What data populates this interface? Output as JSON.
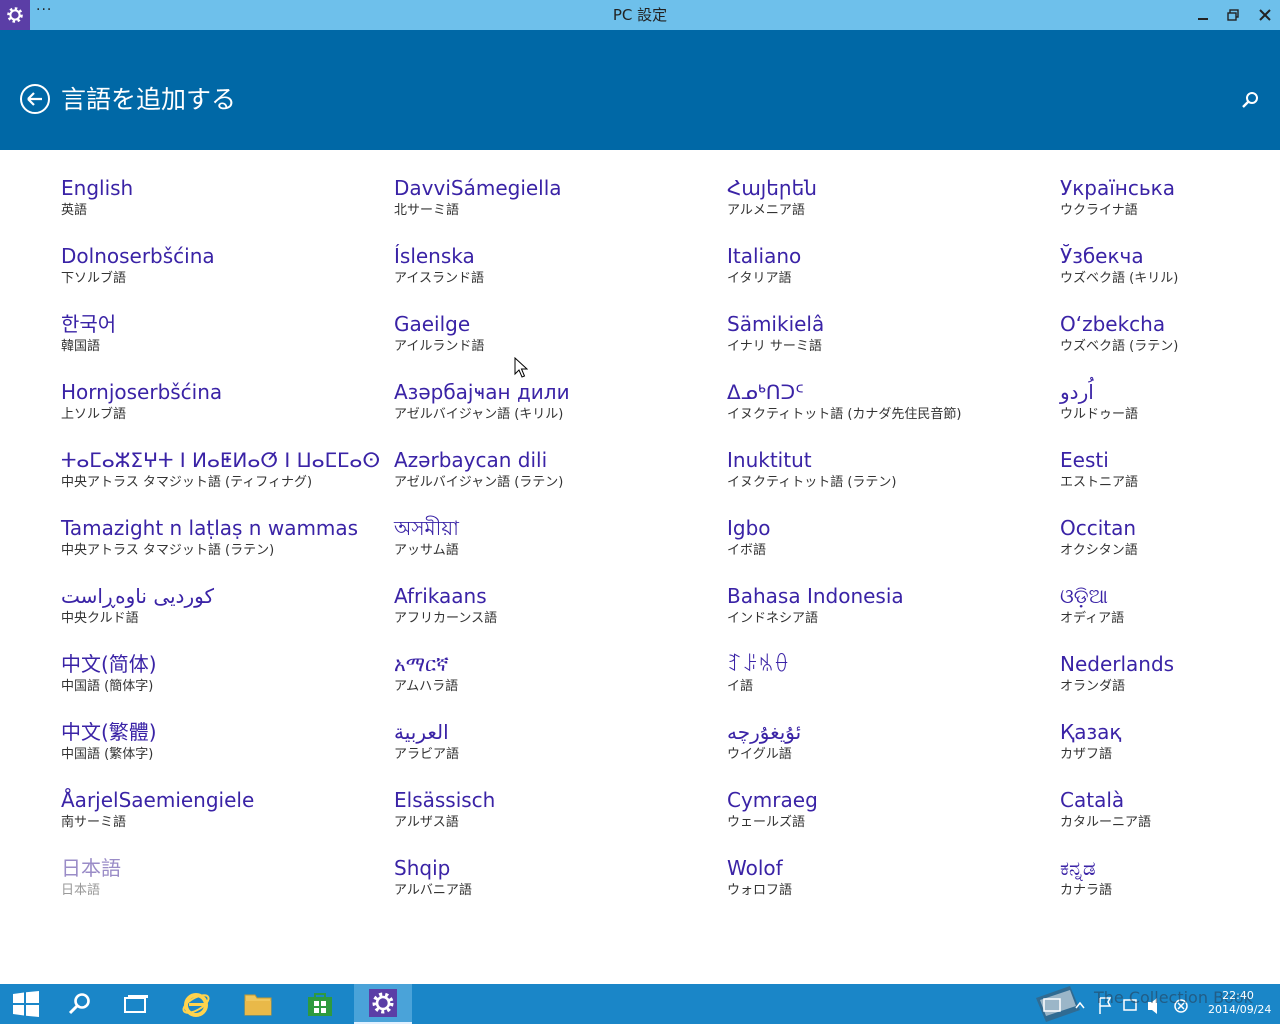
{
  "window": {
    "title": "PC 設定",
    "menu_glyph": "···"
  },
  "header": {
    "title": "言語を追加する"
  },
  "languages": [
    {
      "native": "English",
      "japanese": "英語"
    },
    {
      "native": "Dolnoserbšćina",
      "japanese": "下ソルブ語"
    },
    {
      "native": "한국어",
      "japanese": "韓国語"
    },
    {
      "native": "Hornjoserbšćina",
      "japanese": "上ソルブ語"
    },
    {
      "native": "ⵜⴰⵎⴰⵣⵉⵖⵜ ⵏ ⵍⴰⵟⵍⴰⵚ ⵏ ⵡⴰⵎⵎⴰⵙ",
      "japanese": "中央アトラス タマジット語 (ティフィナグ)"
    },
    {
      "native": "Tamazight n laṭlaṣ n wammas",
      "japanese": "中央アトラス タマジット語 (ラテン)"
    },
    {
      "native": "کوردیی ناوەڕاست",
      "japanese": "中央クルド語"
    },
    {
      "native": "中文(简体)",
      "japanese": "中国語 (簡体字)"
    },
    {
      "native": "中文(繁體)",
      "japanese": "中国語 (繁体字)"
    },
    {
      "native": "ÅarjelSaemiengiele",
      "japanese": "南サーミ語"
    },
    {
      "native": "日本語",
      "japanese": "日本語",
      "disabled": true
    },
    {
      "native": "DavviSámegiella",
      "japanese": "北サーミ語"
    },
    {
      "native": "Íslenska",
      "japanese": "アイスランド語"
    },
    {
      "native": "Gaeilge",
      "japanese": "アイルランド語"
    },
    {
      "native": "Азәрбајҹан дили",
      "japanese": "アゼルバイジャン語 (キリル)"
    },
    {
      "native": "Azərbaycan dili",
      "japanese": "アゼルバイジャン語 (ラテン)"
    },
    {
      "native": "অসমীয়া",
      "japanese": "アッサム語"
    },
    {
      "native": "Afrikaans",
      "japanese": "アフリカーンス語"
    },
    {
      "native": "አማርኛ",
      "japanese": "アムハラ語"
    },
    {
      "native": "العربية",
      "japanese": "アラビア語"
    },
    {
      "native": "Elsässisch",
      "japanese": "アルザス語"
    },
    {
      "native": "Shqip",
      "japanese": "アルバニア語"
    },
    {
      "native": "Հայերեն",
      "japanese": "アルメニア語"
    },
    {
      "native": "Italiano",
      "japanese": "イタリア語"
    },
    {
      "native": "Sämikielâ",
      "japanese": "イナリ サーミ語"
    },
    {
      "native": "ᐃᓄᒃᑎᑐᑦ",
      "japanese": "イヌクティトット語 (カナダ先住民音節)"
    },
    {
      "native": "Inuktitut",
      "japanese": "イヌクティトット語 (ラテン)"
    },
    {
      "native": "Igbo",
      "japanese": "イボ語"
    },
    {
      "native": "Bahasa Indonesia",
      "japanese": "インドネシア語"
    },
    {
      "native": "ꆈꌠꁱꂷ",
      "japanese": "イ語"
    },
    {
      "native": "ئۇيغۇرچە",
      "japanese": "ウイグル語"
    },
    {
      "native": "Cymraeg",
      "japanese": "ウェールズ語"
    },
    {
      "native": "Wolof",
      "japanese": "ウォロフ語"
    },
    {
      "native": "Українська",
      "japanese": "ウクライナ語"
    },
    {
      "native": "Ўзбекча",
      "japanese": "ウズベク語 (キリル)"
    },
    {
      "native": "O‘zbekcha",
      "japanese": "ウズベク語 (ラテン)"
    },
    {
      "native": "اُردو",
      "japanese": "ウルドゥー語"
    },
    {
      "native": "Eesti",
      "japanese": "エストニア語"
    },
    {
      "native": "Occitan",
      "japanese": "オクシタン語"
    },
    {
      "native": "ଓଡ଼ିଆ",
      "japanese": "オディア語"
    },
    {
      "native": "Nederlands",
      "japanese": "オランダ語"
    },
    {
      "native": "Қазақ",
      "japanese": "カザフ語"
    },
    {
      "native": "Català",
      "japanese": "カタルーニア語"
    },
    {
      "native": "ಕನ್ನಡ",
      "japanese": "カナラ語"
    }
  ],
  "taskbar": {
    "buttons": [
      "start-icon",
      "search-icon",
      "task-view-icon",
      "internet-explorer-icon",
      "file-explorer-icon",
      "store-icon",
      "settings-icon"
    ],
    "active": "settings-icon",
    "time": "22:40",
    "date": "2014/09/24",
    "watermark": "The Collection Book"
  },
  "colors": {
    "titlebar": "#6ec0eb",
    "header": "#0068a6",
    "link": "#3a23a6",
    "taskbar": "#1a86c8"
  }
}
